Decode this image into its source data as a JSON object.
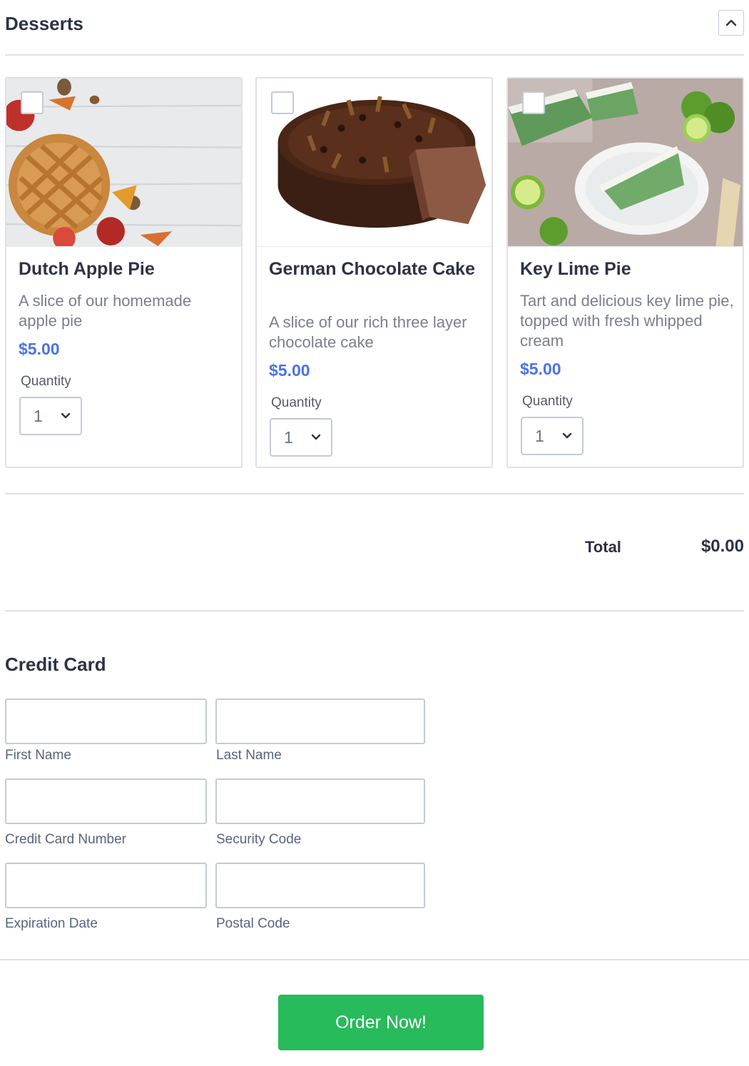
{
  "section": {
    "title": "Desserts"
  },
  "products": [
    {
      "name": "Dutch Apple Pie",
      "description": "A slice of our homemade apple pie",
      "price": "$5.00",
      "quantity_label": "Quantity",
      "quantity": "1",
      "image_icon": "apple-pie-photo"
    },
    {
      "name": "German Chocolate Cake",
      "description": "A slice of our rich three layer chocolate cake",
      "price": "$5.00",
      "quantity_label": "Quantity",
      "quantity": "1",
      "image_icon": "chocolate-cake-photo"
    },
    {
      "name": "Key Lime Pie",
      "description": "Tart and delicious key lime pie, topped with fresh whipped cream",
      "price": "$5.00",
      "quantity_label": "Quantity",
      "quantity": "1",
      "image_icon": "key-lime-pie-photo"
    }
  ],
  "total": {
    "label": "Total",
    "value": "$0.00"
  },
  "credit_card": {
    "title": "Credit Card",
    "fields": {
      "first_name": {
        "label": "First Name",
        "value": ""
      },
      "last_name": {
        "label": "Last Name",
        "value": ""
      },
      "card_number": {
        "label": "Credit Card Number",
        "value": ""
      },
      "security_code": {
        "label": "Security Code",
        "value": ""
      },
      "expiration": {
        "label": "Expiration Date",
        "value": ""
      },
      "postal_code": {
        "label": "Postal Code",
        "value": ""
      }
    }
  },
  "submit": {
    "label": "Order Now!"
  },
  "colors": {
    "price": "#4a73e8",
    "button": "#27bb5b",
    "text": "#2c3345",
    "border": "#c3cad8"
  }
}
